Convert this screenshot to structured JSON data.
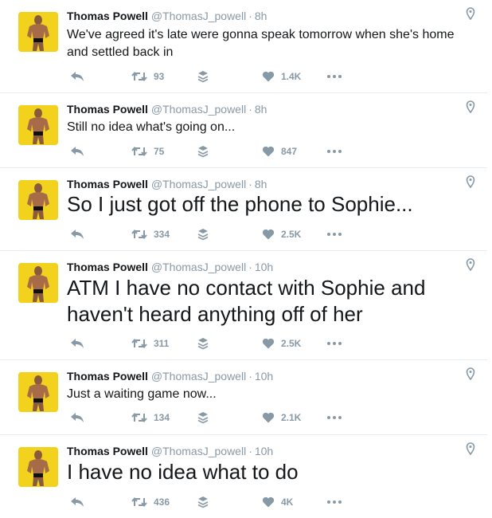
{
  "tweets": [
    {
      "name": "Thomas Powell",
      "handle": "@ThomasJ_powell",
      "time": "8h",
      "text": "We've agreed it's late were gonna speak tomorrow when she's home\nand settled back in",
      "size": "small",
      "retweets": "93",
      "likes": "1.4K"
    },
    {
      "name": "Thomas Powell",
      "handle": "@ThomasJ_powell",
      "time": "8h",
      "text": "Still no idea what's going on...",
      "size": "small",
      "retweets": "75",
      "likes": "847"
    },
    {
      "name": "Thomas Powell",
      "handle": "@ThomasJ_powell",
      "time": "8h",
      "text": "So I just got off the phone to Sophie...",
      "size": "big",
      "retweets": "334",
      "likes": "2.5K"
    },
    {
      "name": "Thomas Powell",
      "handle": "@ThomasJ_powell",
      "time": "10h",
      "text": "ATM I have no contact with Sophie and\nhaven't heard anything off of her",
      "size": "big",
      "retweets": "311",
      "likes": "2.5K"
    },
    {
      "name": "Thomas Powell",
      "handle": "@ThomasJ_powell",
      "time": "10h",
      "text": "Just a waiting game now...",
      "size": "small",
      "retweets": "134",
      "likes": "2.1K"
    },
    {
      "name": "Thomas Powell",
      "handle": "@ThomasJ_powell",
      "time": "10h",
      "text": "I have no idea what to do",
      "size": "big",
      "retweets": "436",
      "likes": "4K"
    }
  ],
  "icons": {
    "reply": "reply-icon",
    "retweet": "retweet-icon",
    "buffer": "buffer-icon",
    "like": "heart-icon",
    "more": "more-icon",
    "location": "location-pin-icon"
  },
  "colors": {
    "icon": "#8899a6",
    "name": "#14171a",
    "divider": "#e6ecf0",
    "avatar_bg": "#f2d21c"
  }
}
